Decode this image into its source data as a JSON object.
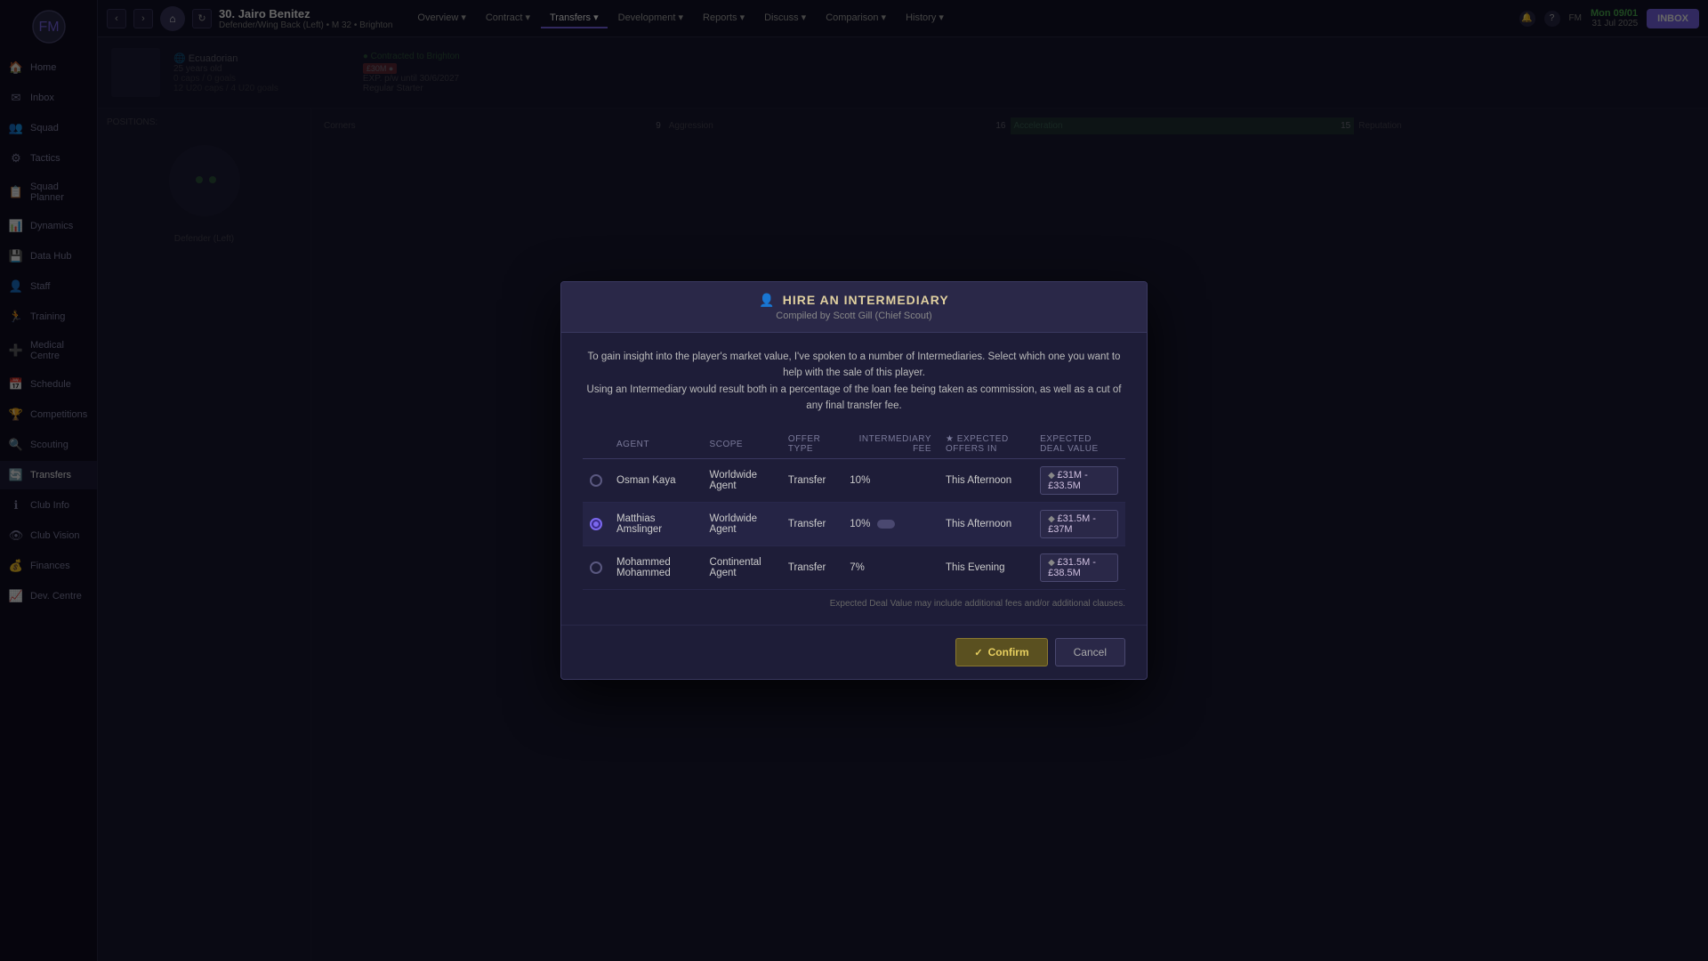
{
  "sidebar": {
    "items": [
      {
        "label": "Home",
        "icon": "🏠",
        "active": false
      },
      {
        "label": "Inbox",
        "icon": "✉",
        "active": false
      },
      {
        "label": "Squad",
        "icon": "👥",
        "active": false
      },
      {
        "label": "Tactics",
        "icon": "⚙",
        "active": false
      },
      {
        "label": "Squad Planner",
        "icon": "📋",
        "active": false
      },
      {
        "label": "Dynamics",
        "icon": "📊",
        "active": false
      },
      {
        "label": "Data Hub",
        "icon": "💾",
        "active": false
      },
      {
        "label": "Staff",
        "icon": "👤",
        "active": false
      },
      {
        "label": "Training",
        "icon": "🏃",
        "active": false
      },
      {
        "label": "Medical Centre",
        "icon": "➕",
        "active": false
      },
      {
        "label": "Schedule",
        "icon": "📅",
        "active": false
      },
      {
        "label": "Competitions",
        "icon": "🏆",
        "active": false
      },
      {
        "label": "Scouting",
        "icon": "🔍",
        "active": false
      },
      {
        "label": "Transfers",
        "icon": "🔄",
        "active": false
      },
      {
        "label": "Club Info",
        "icon": "ℹ",
        "active": false
      },
      {
        "label": "Club Vision",
        "icon": "👁",
        "active": false
      },
      {
        "label": "Finances",
        "icon": "💰",
        "active": false
      },
      {
        "label": "Dev. Centre",
        "icon": "📈",
        "active": false
      }
    ]
  },
  "topbar": {
    "player_number": "30.",
    "player_name": "Jairo Benitez",
    "player_subtitle": "Defender/Wing Back (Left) • M 32 • Brighton",
    "tabs": [
      "Overview",
      "Contract",
      "Transfers",
      "Development",
      "Reports",
      "Discuss",
      "Comparison",
      "History"
    ],
    "active_tab": "Transfers",
    "date_text": "Mon 09/01",
    "date_sub": "31 Jul 2025",
    "inbox_label": "INBOX"
  },
  "modal": {
    "title": "HIRE AN INTERMEDIARY",
    "title_icon": "👤",
    "subtitle": "Compiled by Scott Gill (Chief Scout)",
    "description_line1": "To gain insight into the player's market value, I've spoken to a number of Intermediaries. Select which one you want to help with the sale of this player.",
    "description_line2": "Using an Intermediary would result both in a percentage of the loan fee being taken as commission, as well as a cut of any final transfer fee.",
    "table": {
      "headers": [
        "AGENT",
        "SCOPE",
        "OFFER TYPE",
        "INTERMEDIARY FEE",
        "★ EXPECTED OFFERS IN",
        "EXPECTED DEAL VALUE"
      ],
      "rows": [
        {
          "selected": false,
          "agent": "Osman Kaya",
          "scope": "Worldwide Agent",
          "offer_type": "Transfer",
          "fee": "10%",
          "expected_offers_in": "This Afternoon",
          "deal_value": "£31M - £33.5M"
        },
        {
          "selected": true,
          "agent": "Matthias Amslinger",
          "scope": "Worldwide Agent",
          "offer_type": "Transfer",
          "fee": "10%",
          "expected_offers_in": "This Afternoon",
          "deal_value": "£31.5M - £37M"
        },
        {
          "selected": false,
          "agent": "Mohammed Mohammed",
          "scope": "Continental Agent",
          "offer_type": "Transfer",
          "fee": "7%",
          "expected_offers_in": "This Evening",
          "deal_value": "£31.5M - £38.5M"
        }
      ]
    },
    "footnote": "Expected Deal Value may include additional fees and/or additional clauses.",
    "buttons": {
      "confirm": "Confirm",
      "cancel": "Cancel"
    }
  }
}
